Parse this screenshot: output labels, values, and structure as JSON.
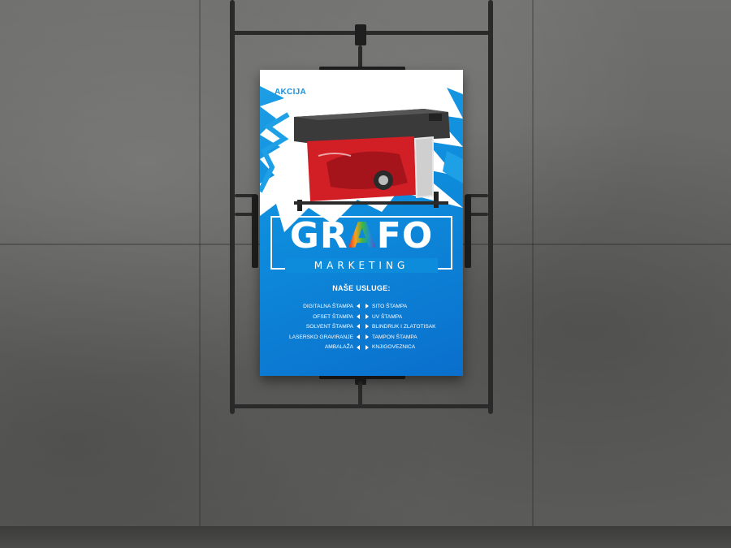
{
  "poster": {
    "badge": "AKCIJA",
    "logo_part1": "GR",
    "logo_part2": "A",
    "logo_part3": "FO",
    "logo_sub": "MARKETING",
    "services_title": "NAŠE USLUGE:",
    "services_left": [
      "DIGITALNA ŠTAMPA",
      "OFSET ŠTAMPA",
      "SOLVENT ŠTAMPA",
      "LASERSKO GRAVIRANJE",
      "AMBALAŽA"
    ],
    "services_right": [
      "SITO ŠTAMPA",
      "UV ŠTAMPA",
      "BLINDRUK I ZLATOTISAK",
      "TAMPON ŠTAMPA",
      "KNJIGOVEZNICA"
    ],
    "printer_brand": "",
    "colors": {
      "poster_blue": "#0e8cdc",
      "accent_red": "#d11f25",
      "wall_gray": "#6b6b6a",
      "frame_black": "#2a2a2a"
    }
  }
}
